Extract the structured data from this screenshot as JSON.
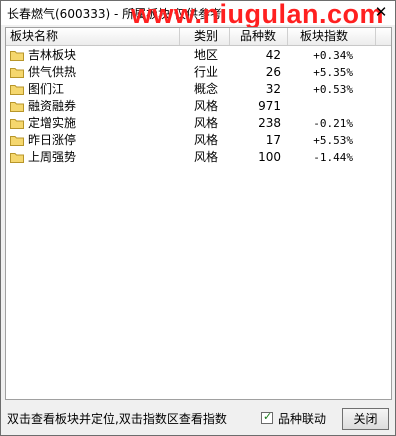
{
  "window": {
    "title": "长春燃气(600333) - 所属板块 仅供参考",
    "watermark": "www.niugulan.com",
    "close_glyph": "✕"
  },
  "table": {
    "columns": [
      "板块名称",
      "类别",
      "品种数",
      "板块指数"
    ],
    "rows": [
      {
        "name": "吉林板块",
        "type": "地区",
        "count": "42",
        "index": "+0.34%",
        "icon": "folder-icon"
      },
      {
        "name": "供气供热",
        "type": "行业",
        "count": "26",
        "index": "+5.35%",
        "icon": "folder-icon"
      },
      {
        "name": "图们江",
        "type": "概念",
        "count": "32",
        "index": "+0.53%",
        "icon": "folder-icon"
      },
      {
        "name": "融资融券",
        "type": "风格",
        "count": "971",
        "index": "",
        "icon": "folder-icon"
      },
      {
        "name": "定增实施",
        "type": "风格",
        "count": "238",
        "index": "-0.21%",
        "icon": "folder-icon"
      },
      {
        "name": "昨日涨停",
        "type": "风格",
        "count": "17",
        "index": "+5.53%",
        "icon": "folder-icon"
      },
      {
        "name": "上周强势",
        "type": "风格",
        "count": "100",
        "index": "-1.44%",
        "icon": "folder-icon"
      }
    ]
  },
  "status": {
    "hint": "双击查看板块并定位,双击指数区查看指数",
    "checkbox_label": "品种联动",
    "checkbox_checked": true,
    "close_button_label": "关闭"
  },
  "colors": {
    "watermark": "#ff2020",
    "folder": "#f5d76e",
    "folder_outline": "#b8962a"
  }
}
